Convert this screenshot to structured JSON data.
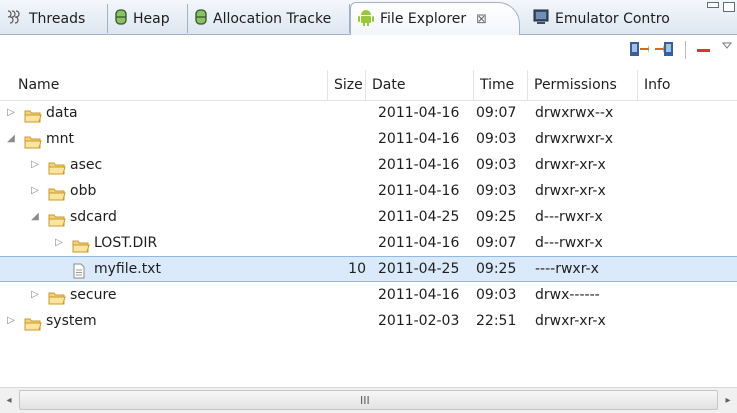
{
  "tabs": [
    {
      "label": "Threads",
      "icon": "threads-icon"
    },
    {
      "label": "Heap",
      "icon": "heap-icon"
    },
    {
      "label": "Allocation Tracke",
      "icon": "allocation-tracker-icon"
    },
    {
      "label": "File Explorer",
      "icon": "android-icon",
      "active": true,
      "close": "⊠"
    },
    {
      "label": "Emulator Contro",
      "icon": "emulator-control-icon"
    }
  ],
  "toolbar": {
    "pull_icon": "pull-file-icon",
    "push_icon": "push-file-icon",
    "delete_icon": "delete-icon",
    "menu_icon": "view-menu-icon",
    "delete_color": "#e03030"
  },
  "columns": {
    "name": "Name",
    "size": "Size",
    "date": "Date",
    "time": "Time",
    "permissions": "Permissions",
    "info": "Info"
  },
  "rows": [
    {
      "level": 0,
      "expander": "▷",
      "icon": "folder-icon",
      "name": "data",
      "size": "",
      "date": "2011-04-16",
      "time": "09:07",
      "permissions": "drwxrwx--x"
    },
    {
      "level": 0,
      "expander": "◢",
      "icon": "folder-icon",
      "name": "mnt",
      "size": "",
      "date": "2011-04-16",
      "time": "09:03",
      "permissions": "drwxrwxr-x"
    },
    {
      "level": 1,
      "expander": "▷",
      "icon": "folder-icon",
      "name": "asec",
      "size": "",
      "date": "2011-04-16",
      "time": "09:03",
      "permissions": "drwxr-xr-x"
    },
    {
      "level": 1,
      "expander": "▷",
      "icon": "folder-icon",
      "name": "obb",
      "size": "",
      "date": "2011-04-16",
      "time": "09:03",
      "permissions": "drwxr-xr-x"
    },
    {
      "level": 1,
      "expander": "◢",
      "icon": "folder-icon",
      "name": "sdcard",
      "size": "",
      "date": "2011-04-25",
      "time": "09:25",
      "permissions": "d---rwxr-x"
    },
    {
      "level": 2,
      "expander": "▷",
      "icon": "folder-icon",
      "name": "LOST.DIR",
      "size": "",
      "date": "2011-04-16",
      "time": "09:07",
      "permissions": "d---rwxr-x"
    },
    {
      "level": 2,
      "expander": "",
      "icon": "file-icon",
      "name": "myfile.txt",
      "size": "10",
      "date": "2011-04-25",
      "time": "09:25",
      "permissions": "----rwxr-x",
      "selected": true
    },
    {
      "level": 1,
      "expander": "▷",
      "icon": "folder-icon",
      "name": "secure",
      "size": "",
      "date": "2011-04-16",
      "time": "09:03",
      "permissions": "drwx------"
    },
    {
      "level": 0,
      "expander": "▷",
      "icon": "folder-icon",
      "name": "system",
      "size": "",
      "date": "2011-02-03",
      "time": "22:51",
      "permissions": "drwxr-xr-x"
    }
  ],
  "scrollbar": {
    "left": "◂",
    "right": "▸",
    "grip": "III"
  }
}
